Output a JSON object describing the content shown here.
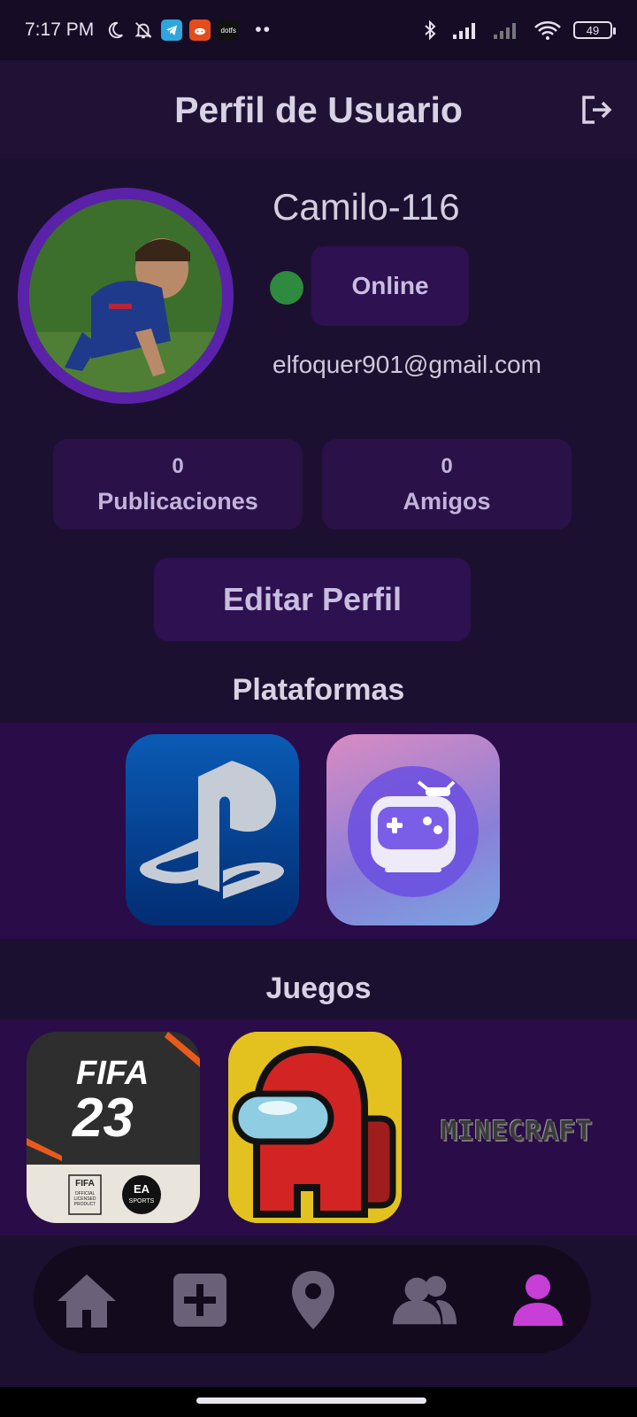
{
  "status_bar": {
    "time": "7:17 PM",
    "battery": "49",
    "icons": [
      "moon-icon",
      "bell-off-icon",
      "telegram-icon",
      "reddit-icon",
      "dotfs-icon",
      "more-dots-icon",
      "bluetooth-icon",
      "signal-icon",
      "signal-icon",
      "wifi-icon",
      "battery-icon"
    ],
    "app_label_dotfs": "dotfs"
  },
  "header": {
    "title": "Perfil de Usuario",
    "logout_icon": "logout-icon"
  },
  "profile": {
    "username": "Camilo-116",
    "status_label": "Online",
    "status_color": "#2e8a3e",
    "email": "elfoquer901@gmail.com",
    "stats": [
      {
        "count": "0",
        "label": "Publicaciones"
      },
      {
        "count": "0",
        "label": "Amigos"
      }
    ],
    "edit_label": "Editar Perfil"
  },
  "platforms": {
    "title": "Plataformas",
    "items": [
      "playstation-icon",
      "game-bot-icon"
    ]
  },
  "games": {
    "title": "Juegos",
    "fifa": {
      "title": "FIFA",
      "number": "23",
      "badge": "FIFA",
      "badge_sub": "OFFICIAL LICENSED PRODUCT",
      "ea": "EA",
      "ea_sub": "SPORTS"
    },
    "minecraft": "MINECRAFT"
  },
  "nav": {
    "items": [
      "home-icon",
      "add-icon",
      "location-icon",
      "friends-icon",
      "profile-icon"
    ],
    "active_color": "#c73fd6"
  }
}
